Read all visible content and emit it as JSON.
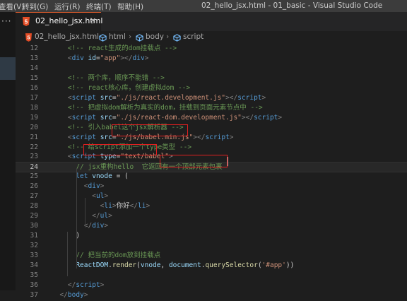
{
  "menubar": {
    "items": [
      "查看(V)",
      "转到(G)",
      "运行(R)",
      "终端(T)",
      "帮助(H)"
    ],
    "window_title": "02_hello_jsx.html - 01_basic - Visual Studio Code"
  },
  "activity_bar": {
    "more_icon": "ellipsis-icon"
  },
  "tab": {
    "label": "02_hello_jsx.html",
    "close_glyph": "×",
    "icon": "html5-icon"
  },
  "breadcrumb": {
    "items": [
      {
        "label": "02_hello_jsx.html",
        "icon": "html5-icon"
      },
      {
        "label": "html",
        "icon": "cube-icon"
      },
      {
        "label": "body",
        "icon": "cube-icon"
      },
      {
        "label": "script",
        "icon": "cube-icon"
      }
    ],
    "separator": "›"
  },
  "editor": {
    "active_line": 24,
    "lines": [
      {
        "n": "12",
        "tokens": [
          [
            "i",
            "    "
          ],
          [
            "c",
            "<!-- react生成的dom挂载点 -->"
          ]
        ]
      },
      {
        "n": "13",
        "tokens": [
          [
            "i",
            "    "
          ],
          [
            "p",
            "<"
          ],
          [
            "t",
            "div"
          ],
          [
            "d",
            " "
          ],
          [
            "a",
            "id"
          ],
          [
            "d",
            "="
          ],
          [
            "s",
            "\"app\""
          ],
          [
            "p",
            "></"
          ],
          [
            "t",
            "div"
          ],
          [
            "p",
            ">"
          ]
        ]
      },
      {
        "n": "14",
        "tokens": []
      },
      {
        "n": "15",
        "tokens": [
          [
            "i",
            "    "
          ],
          [
            "c",
            "<!-- 两个库，顺序不能错 -->"
          ]
        ]
      },
      {
        "n": "16",
        "tokens": [
          [
            "i",
            "    "
          ],
          [
            "c",
            "<!-- react核心库，创建虚拟dom -->"
          ]
        ]
      },
      {
        "n": "17",
        "tokens": [
          [
            "i",
            "    "
          ],
          [
            "p",
            "<"
          ],
          [
            "t",
            "script"
          ],
          [
            "d",
            " "
          ],
          [
            "a",
            "src"
          ],
          [
            "d",
            "="
          ],
          [
            "s",
            "\"./js/react.development.js\""
          ],
          [
            "p",
            "></"
          ],
          [
            "t",
            "script"
          ],
          [
            "p",
            ">"
          ]
        ]
      },
      {
        "n": "18",
        "tokens": [
          [
            "i",
            "    "
          ],
          [
            "c",
            "<!-- 把虚拟dom解析为真实的dom，挂载到页面元素节点中 -->"
          ]
        ]
      },
      {
        "n": "19",
        "tokens": [
          [
            "i",
            "    "
          ],
          [
            "p",
            "<"
          ],
          [
            "t",
            "script"
          ],
          [
            "d",
            " "
          ],
          [
            "a",
            "src"
          ],
          [
            "d",
            "="
          ],
          [
            "s",
            "\"./js/react-dom.development.js\""
          ],
          [
            "p",
            "></"
          ],
          [
            "t",
            "script"
          ],
          [
            "p",
            ">"
          ]
        ]
      },
      {
        "n": "20",
        "tokens": [
          [
            "i",
            "    "
          ],
          [
            "c",
            "<!-- 引入babel这个jsx解析器 -->"
          ]
        ]
      },
      {
        "n": "21",
        "tokens": [
          [
            "i",
            "    "
          ],
          [
            "p",
            "<"
          ],
          [
            "t",
            "script"
          ],
          [
            "d",
            " "
          ],
          [
            "a",
            "src"
          ],
          [
            "d",
            "="
          ],
          [
            "s",
            "\"./js/babel.min.js\""
          ],
          [
            "p",
            "></"
          ],
          [
            "t",
            "script"
          ],
          [
            "p",
            ">"
          ]
        ]
      },
      {
        "n": "22",
        "tokens": [
          [
            "i",
            "    "
          ],
          [
            "c",
            "<!-- 给script添加一个type类型 -->"
          ]
        ]
      },
      {
        "n": "23",
        "tokens": [
          [
            "i",
            "    "
          ],
          [
            "p",
            "<"
          ],
          [
            "t",
            "script"
          ],
          [
            "d",
            " "
          ],
          [
            "a",
            "type"
          ],
          [
            "d",
            "="
          ],
          [
            "s",
            "\"text/babel\""
          ],
          [
            "p",
            ">"
          ]
        ]
      },
      {
        "n": "24",
        "tokens": [
          [
            "i",
            "      "
          ],
          [
            "c",
            "// jsx重构hello  它返回有一个顶部元素包裹"
          ]
        ]
      },
      {
        "n": "25",
        "tokens": [
          [
            "i",
            "      "
          ],
          [
            "k",
            "let"
          ],
          [
            "d",
            " "
          ],
          [
            "v",
            "vnode"
          ],
          [
            "d",
            " = ("
          ]
        ]
      },
      {
        "n": "26",
        "tokens": [
          [
            "i",
            "        "
          ],
          [
            "p",
            "<"
          ],
          [
            "t",
            "div"
          ],
          [
            "p",
            ">"
          ]
        ]
      },
      {
        "n": "27",
        "tokens": [
          [
            "i",
            "          "
          ],
          [
            "p",
            "<"
          ],
          [
            "t",
            "ul"
          ],
          [
            "p",
            ">"
          ]
        ]
      },
      {
        "n": "28",
        "tokens": [
          [
            "i",
            "            "
          ],
          [
            "p",
            "<"
          ],
          [
            "t",
            "li"
          ],
          [
            "p",
            ">"
          ],
          [
            "d",
            "你好"
          ],
          [
            "p",
            "</"
          ],
          [
            "t",
            "li"
          ],
          [
            "p",
            ">"
          ]
        ]
      },
      {
        "n": "29",
        "tokens": [
          [
            "i",
            "          "
          ],
          [
            "p",
            "</"
          ],
          [
            "t",
            "ul"
          ],
          [
            "p",
            ">"
          ]
        ]
      },
      {
        "n": "30",
        "tokens": [
          [
            "i",
            "        "
          ],
          [
            "p",
            "</"
          ],
          [
            "t",
            "div"
          ],
          [
            "p",
            ">"
          ]
        ]
      },
      {
        "n": "31",
        "tokens": [
          [
            "i",
            "      "
          ],
          [
            "d",
            ")"
          ]
        ]
      },
      {
        "n": "32",
        "tokens": []
      },
      {
        "n": "33",
        "tokens": [
          [
            "i",
            "      "
          ],
          [
            "c",
            "// 把当前的dom放到挂载点"
          ]
        ]
      },
      {
        "n": "34",
        "tokens": [
          [
            "i",
            "      "
          ],
          [
            "v",
            "ReactDOM"
          ],
          [
            "d",
            "."
          ],
          [
            "f",
            "render"
          ],
          [
            "d",
            "("
          ],
          [
            "v",
            "vnode"
          ],
          [
            "d",
            ", "
          ],
          [
            "v",
            "document"
          ],
          [
            "d",
            "."
          ],
          [
            "f",
            "querySelector"
          ],
          [
            "d",
            "("
          ],
          [
            "s",
            "'#app'"
          ],
          [
            "d",
            "))"
          ]
        ]
      },
      {
        "n": "35",
        "tokens": []
      },
      {
        "n": "36",
        "tokens": [
          [
            "i",
            "    "
          ],
          [
            "p",
            "</"
          ],
          [
            "t",
            "script"
          ],
          [
            "p",
            ">"
          ]
        ]
      },
      {
        "n": "37",
        "tokens": [
          [
            "i",
            "  "
          ],
          [
            "p",
            "</"
          ],
          [
            "t",
            "body"
          ],
          [
            "p",
            ">"
          ]
        ]
      }
    ]
  },
  "colors": {
    "comment": "#6a9955",
    "punct": "#808080",
    "tag": "#569cd6",
    "attr": "#9cdcfe",
    "string": "#ce9178",
    "text": "#d4d4d4",
    "keyword": "#569cd6",
    "function": "#dcdcaa",
    "variable": "#9cdcfe",
    "annotation_box": "#e02020",
    "tab_accent": "#e05c2c"
  }
}
